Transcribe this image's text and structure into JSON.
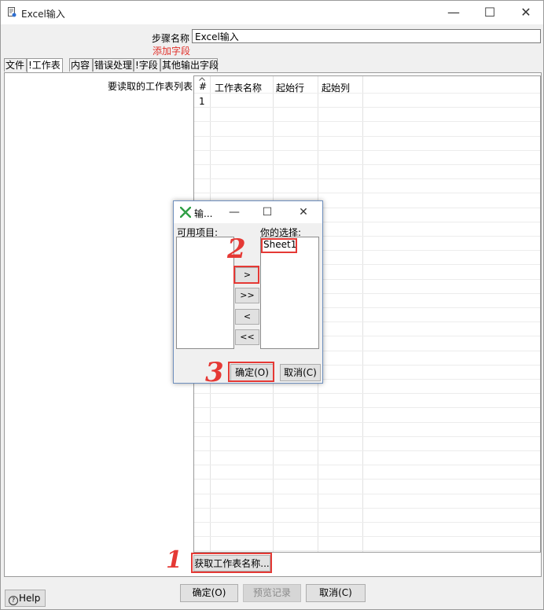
{
  "window": {
    "title": "Excel输入",
    "minimize": "—",
    "maximize": "☐",
    "close": "✕"
  },
  "step": {
    "label": "步骤名称",
    "value": "Excel输入",
    "add_field": "添加字段"
  },
  "tabs": [
    {
      "label": "文件"
    },
    {
      "label": "!工作表"
    },
    {
      "label": "内容"
    },
    {
      "label": "错误处理"
    },
    {
      "label": "!字段"
    },
    {
      "label": "其他输出字段"
    }
  ],
  "sheets_table": {
    "label": "要读取的工作表列表",
    "columns": [
      "#",
      "工作表名称",
      "起始行",
      "起始列"
    ],
    "rows": [
      {
        "num": "1"
      }
    ]
  },
  "get_sheet_button": "获取工作表名称...",
  "buttons": {
    "ok": "确定(O)",
    "preview": "预览记录",
    "cancel": "取消(C)",
    "help": "Help"
  },
  "dialog": {
    "title": "输...",
    "available_label": "可用项目:",
    "selected_label": "你的选择:",
    "selected_items": [
      "Sheet1"
    ],
    "arrows": [
      ">",
      ">>",
      "<",
      "<<"
    ],
    "ok": "确定(O)",
    "cancel": "取消(C)"
  },
  "annotations": [
    "1",
    "2",
    "3"
  ],
  "colors": {
    "annotation_red": "#e53935",
    "add_field_red": "#e0302a",
    "dialog_icon_green": "#2e9e44"
  }
}
